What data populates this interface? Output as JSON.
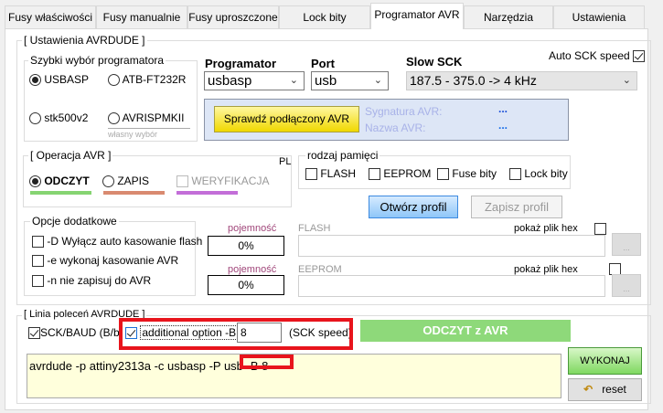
{
  "tabs": [
    "Fusy właściwości",
    "Fusy manualnie",
    "Fusy uproszczone",
    "Lock bity",
    "Programator AVR",
    "Narzędzia",
    "Ustawienia"
  ],
  "settings": {
    "title": "[ Ustawienia AVRDUDE ]",
    "quick_title": "Szybki wybór programatora",
    "radios": [
      "USBASP",
      "ATB-FT232R",
      "stk500v2",
      "AVRISPMKII"
    ],
    "custom_label": "własny wybór",
    "programmer_label": "Programator",
    "programmer_value": "usbasp",
    "port_label": "Port",
    "port_value": "usb",
    "slow_label": "Slow SCK",
    "slow_value": "187.5 - 375.0 -> 4 kHz",
    "auto_sck_label": "Auto SCK speed",
    "check_button": "Sprawdź podłączony AVR",
    "signature_label": "Sygnatura AVR:",
    "signature_value": "...",
    "name_label": "Nazwa AVR:",
    "name_value": "..."
  },
  "operation": {
    "title": "[ Operacja AVR ]",
    "lang": "PL",
    "read": "ODCZYT",
    "write": "ZAPIS",
    "verify": "WERYFIKACJA",
    "colors": {
      "read": "#86d472",
      "write": "#d98a70",
      "verify": "#c36ed8"
    }
  },
  "memory": {
    "title": "rodzaj pamięci",
    "items": [
      "FLASH",
      "EEPROM",
      "Fuse bity",
      "Lock bity"
    ],
    "open_profile": "Otwórz profil",
    "save_profile": "Zapisz profil"
  },
  "options": {
    "title": "Opcje dodatkowe",
    "items": [
      "-D Wyłącz auto kasowanie flash",
      "-e wykonaj kasowanie AVR",
      "-n nie zapisuj do AVR"
    ]
  },
  "files": {
    "capacity_label": "pojemność",
    "flash_label": "FLASH",
    "flash_pct": "0%",
    "eeprom_label": "EEPROM",
    "eeprom_pct": "0%",
    "show_hex": "pokaż plik hex",
    "browse": "..."
  },
  "cmd": {
    "title": "[ Linia poleceń AVRDUDE ]",
    "sck_baud": "SCK/BAUD (B/b)",
    "additional": "additional option -B",
    "b_value": "8",
    "sck_speed": "(SCK speed)",
    "action": "ODCZYT z AVR",
    "command": "avrdude -p attiny2313a -c usbasp -P usb -B 8",
    "execute": "WYKONAJ",
    "reset": "reset"
  }
}
